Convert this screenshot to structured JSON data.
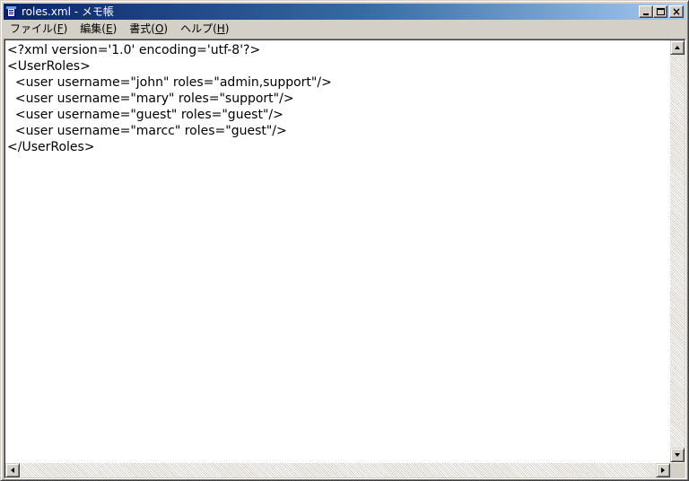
{
  "window": {
    "title": "roles.xml - メモ帳",
    "icon": "notepad-icon"
  },
  "menu": [
    {
      "label": "ファイル(",
      "accel": "F",
      "close": ")"
    },
    {
      "label": "編集(",
      "accel": "E",
      "close": ")"
    },
    {
      "label": "書式(",
      "accel": "O",
      "close": ")"
    },
    {
      "label": "ヘルプ(",
      "accel": "H",
      "close": ")"
    }
  ],
  "document": {
    "lines": [
      "<?xml version='1.0' encoding='utf-8'?>",
      "<UserRoles>",
      "  <user username=\"john\" roles=\"admin,support\"/>",
      "  <user username=\"mary\" roles=\"support\"/>",
      "  <user username=\"guest\" roles=\"guest\"/>",
      "  <user username=\"marcc\" roles=\"guest\"/>",
      "</UserRoles>"
    ]
  },
  "caption_buttons": {
    "minimize": "minimize-icon",
    "maximize": "maximize-icon",
    "close": "close-icon"
  },
  "colors": {
    "titlebar_start": "#0a246a",
    "titlebar_end": "#a6caf0",
    "chrome": "#d4d0c8",
    "editor_bg": "#ffffff"
  }
}
